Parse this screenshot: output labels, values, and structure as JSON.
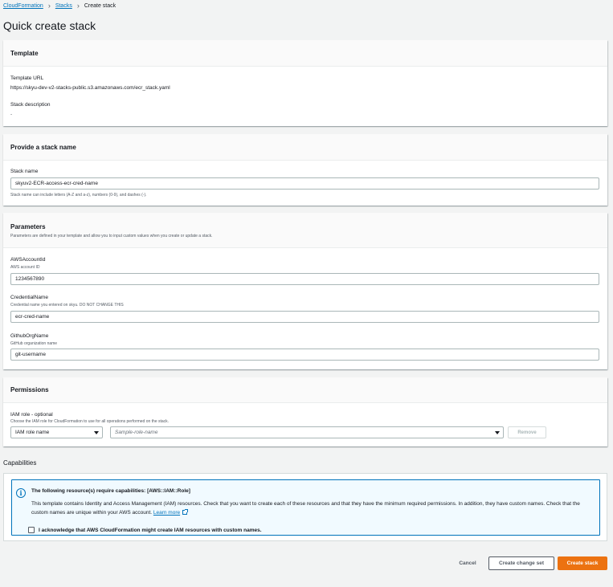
{
  "breadcrumb": {
    "items": [
      "CloudFormation",
      "Stacks"
    ],
    "current": "Create stack"
  },
  "page_title": "Quick create stack",
  "template": {
    "header": "Template",
    "url_label": "Template URL",
    "url_value": "https://skyu-dev-v2-stacks-public.s3.amazonaws.com/ecr_stack.yaml",
    "desc_label": "Stack description",
    "desc_value": "-"
  },
  "stack_name": {
    "header": "Provide a stack name",
    "label": "Stack name",
    "value": "skyuv2-ECR-access-ecr-cred-name",
    "hint": "Stack name can include letters (A-Z and a-z), numbers (0-9), and dashes (-)."
  },
  "parameters": {
    "header": "Parameters",
    "description": "Parameters are defined in your template and allow you to input custom values when you create or update a stack.",
    "fields": [
      {
        "label": "AWSAccountId",
        "sublabel": "AWS account ID",
        "value": "1234567890"
      },
      {
        "label": "CredentialName",
        "sublabel": "Credential name you entered on skyu. DO NOT CHANGE THIS",
        "value": "ecr-cred-name"
      },
      {
        "label": "GithubOrgName",
        "sublabel": "GitHub organization name",
        "value": "git-username"
      }
    ]
  },
  "permissions": {
    "header": "Permissions",
    "label": "IAM role - optional",
    "sublabel": "Choose the IAM role for CloudFormation to use for all operations performed on the stack.",
    "role_type": "IAM role name",
    "role_placeholder": "Sample-role-name",
    "remove_label": "Remove"
  },
  "capabilities": {
    "title": "Capabilities",
    "alert_title": "The following resource(s) require capabilities: [AWS::IAM::Role]",
    "alert_body": "This template contains Identity and Access Management (IAM) resources. Check that you want to create each of these resources and that they have the minimum required permissions. In addition, they have custom names. Check that the custom names are unique within your AWS account.",
    "learn_more": "Learn more",
    "acknowledge": "I acknowledge that AWS CloudFormation might create IAM resources with custom names."
  },
  "footer": {
    "cancel": "Cancel",
    "change_set": "Create change set",
    "create": "Create stack"
  },
  "colors": {
    "link": "#0073bb",
    "primary": "#ec7211",
    "background": "#f2f3f3"
  }
}
